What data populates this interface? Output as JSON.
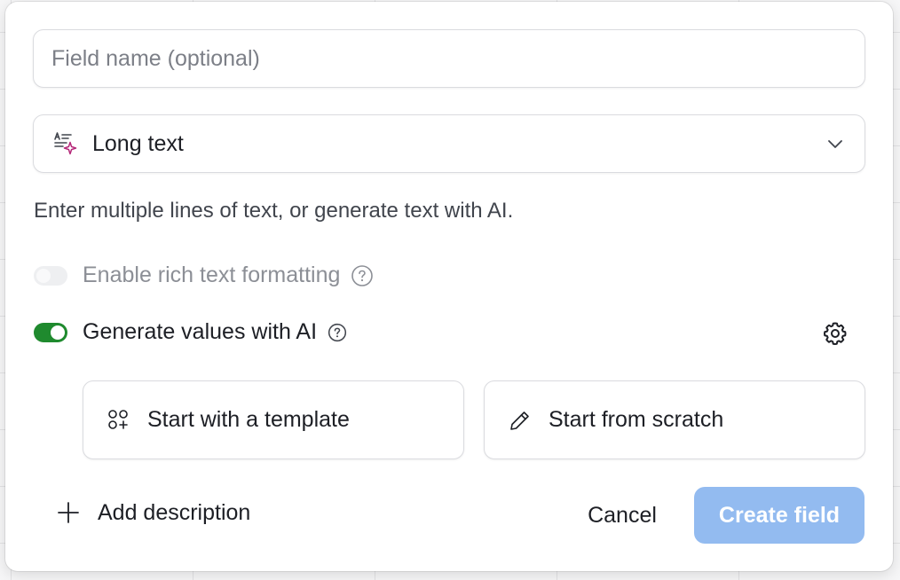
{
  "field_name": {
    "value": "",
    "placeholder": "Field name (optional)"
  },
  "field_type": {
    "label": "Long text",
    "icon": "long-text-ai-icon"
  },
  "description": "Enter multiple lines of text, or generate text with AI.",
  "rich_text": {
    "label": "Enable rich text formatting",
    "enabled": false,
    "disabled": true
  },
  "generate_ai": {
    "label": "Generate values with AI",
    "enabled": true
  },
  "options": {
    "template_label": "Start with a template",
    "scratch_label": "Start from scratch"
  },
  "footer": {
    "add_description_label": "Add description",
    "cancel_label": "Cancel",
    "create_label": "Create field"
  },
  "colors": {
    "toggle_on": "#1f8a2e",
    "create_disabled": "#93bbf0",
    "ai_sparkle": "#b5297a"
  }
}
